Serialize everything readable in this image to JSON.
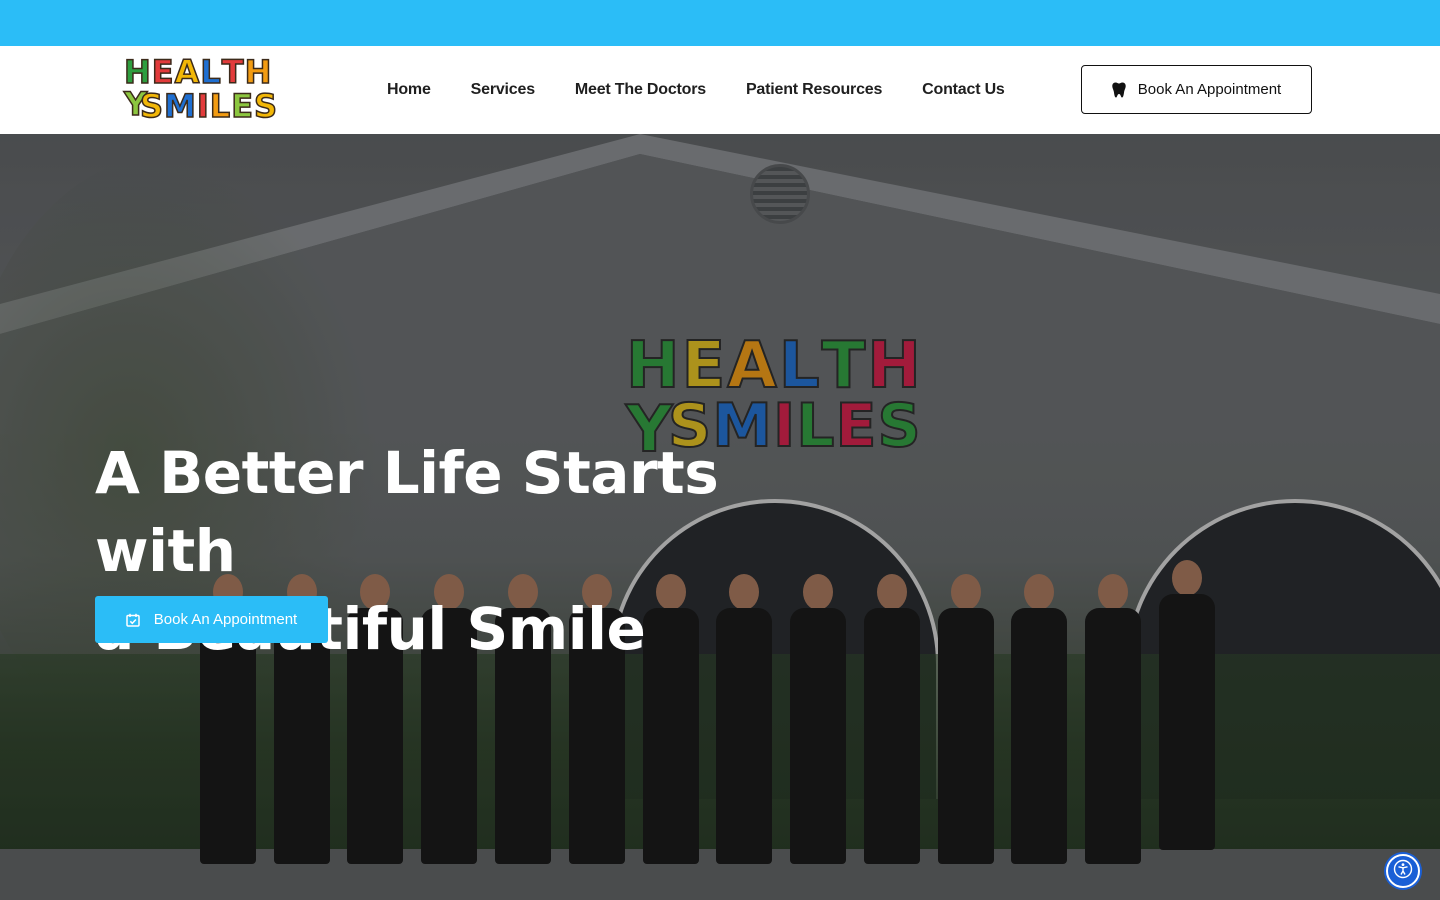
{
  "header": {
    "logo": {
      "line1": [
        "H",
        "E",
        "A",
        "L",
        "T",
        "H",
        "Y"
      ],
      "line2": [
        "S",
        "M",
        "I",
        "L",
        "E",
        "S"
      ],
      "colors": [
        "#2e9e3f",
        "#e23b3b",
        "#f2b707",
        "#1f6fd1",
        "#e23b3b",
        "#f39c12",
        "#8cc63f"
      ]
    },
    "nav": [
      {
        "label": "Home"
      },
      {
        "label": "Services"
      },
      {
        "label": "Meet The Doctors"
      },
      {
        "label": "Patient Resources"
      },
      {
        "label": "Contact Us"
      }
    ],
    "cta": {
      "label": "Book An Appointment",
      "icon": "tooth-icon"
    }
  },
  "hero": {
    "sign": {
      "line1": [
        "H",
        "E",
        "A",
        "L",
        "T",
        "H",
        "Y"
      ],
      "line2": [
        "S",
        "M",
        "I",
        "L",
        "E",
        "S"
      ],
      "colors_top": [
        "#2e9e3f",
        "#e6c21f",
        "#f39c12",
        "#1f6fd1",
        "#2e9e3f",
        "#d81e4a",
        "#2e9e3f"
      ],
      "colors_bottom": [
        "#e6c21f",
        "#1f6fd1",
        "#d81e4a",
        "#2e9e3f",
        "#d81e4a",
        "#2e9e3f"
      ]
    },
    "title_line1": "A Better Life Starts with",
    "title_line2": "a Beautiful Smile",
    "cta": {
      "label": "Book An Appointment",
      "icon": "calendar-check-icon"
    },
    "photo_alt": "Healthy Smiles team standing in front of the office building"
  },
  "accessibility": {
    "icon": "accessibility-icon"
  },
  "colors": {
    "accent": "#2bbdf7",
    "a11y": "#1a5fd6"
  }
}
